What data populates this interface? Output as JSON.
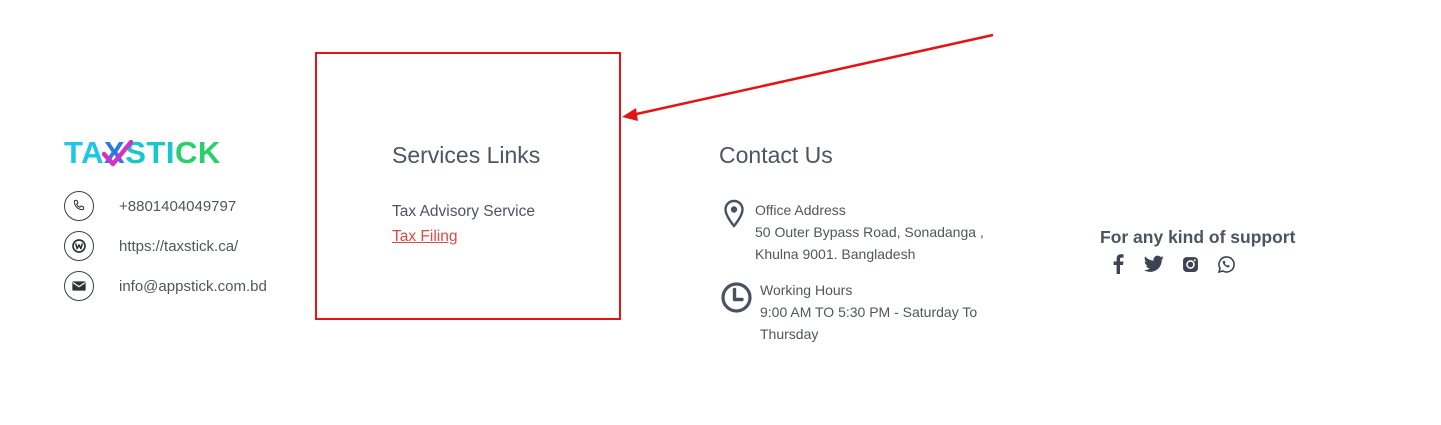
{
  "brand": {
    "logo_parts": [
      "TA",
      "X",
      "STI",
      "CK"
    ],
    "logo_text": "TAXSTICK"
  },
  "contacts": [
    {
      "icon": "phone-icon",
      "text": "+8801404049797"
    },
    {
      "icon": "globe-icon",
      "text": "https://taxstick.ca/"
    },
    {
      "icon": "mail-icon",
      "text": "info@appstick.com.bd"
    }
  ],
  "services": {
    "title": "Services Links",
    "items": [
      {
        "label": "Tax Advisory Service"
      },
      {
        "label": "Tax Filing"
      }
    ]
  },
  "contact_us": {
    "title": "Contact Us",
    "office": {
      "title": "Office Address",
      "line1": "50 Outer Bypass Road, Sonadanga ,",
      "line2": "Khulna 9001. Bangladesh"
    },
    "hours": {
      "title": "Working Hours",
      "line1": "9:00 AM TO 5:30 PM - Saturday To",
      "line2": "Thursday"
    }
  },
  "support": {
    "title": "For any kind of support",
    "social": [
      "facebook-icon",
      "twitter-icon",
      "instagram-icon",
      "whatsapp-icon"
    ]
  },
  "annotation": {
    "color": "#e31414"
  }
}
